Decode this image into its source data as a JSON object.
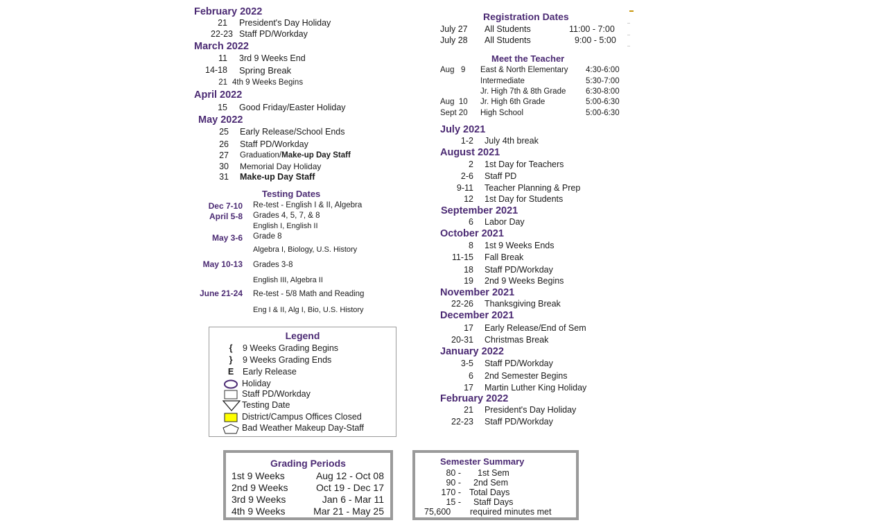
{
  "left_column": {
    "months": [
      {
        "title": "February 2022",
        "events": [
          {
            "date": "21",
            "text": "President's Day Holiday"
          },
          {
            "date": "22-23",
            "text": "Staff PD/Workday"
          }
        ]
      },
      {
        "title": "March 2022",
        "events": [
          {
            "date": "11",
            "text": "3rd 9 Weeks End"
          },
          {
            "date": "14-18",
            "text": "Spring Break"
          },
          {
            "date": "21",
            "text": "4th 9 Weeks Begins"
          }
        ]
      },
      {
        "title": "April 2022",
        "events": [
          {
            "date": "15",
            "text": "Good Friday/Easter Holiday"
          }
        ]
      },
      {
        "title": "May 2022",
        "events": [
          {
            "date": "25",
            "text": "Early Release/School Ends"
          },
          {
            "date": "26",
            "text": "Staff PD/Workday"
          },
          {
            "date": "27",
            "text": "Graduation/",
            "bold_text": "Make-up Day Staff"
          },
          {
            "date": "30",
            "text": "Memorial Day Holiday"
          },
          {
            "date": "31",
            "text": "",
            "bold_text": "Make-up Day Staff"
          }
        ]
      }
    ]
  },
  "testing": {
    "title": "Testing Dates",
    "rows": [
      {
        "date": "Dec 7-10",
        "lines": [
          "Re-test - English I & II, Algebra"
        ]
      },
      {
        "date": "April 5-8",
        "lines": [
          "Grades 4, 5, 7, & 8",
          "English I, English II"
        ]
      },
      {
        "date": "May 3-6",
        "lines": [
          "Grade 8",
          "Algebra I, Biology, U.S. History"
        ]
      },
      {
        "date": "May 10-13",
        "lines": [
          "Grades 3-8",
          "English III, Algebra II"
        ]
      },
      {
        "date": "June 21-24",
        "lines": [
          "Re-test - 5/8 Math and Reading",
          "Eng I & II, Alg I, Bio, U.S. History"
        ]
      }
    ]
  },
  "legend": {
    "title": "Legend",
    "items": [
      {
        "symbol": "{",
        "icon": "open-brace-icon",
        "label": "9 Weeks Grading Begins"
      },
      {
        "symbol": "}",
        "icon": "close-brace-icon",
        "label": "9 Weeks Grading Ends"
      },
      {
        "symbol": "E",
        "icon": "letter-e-icon",
        "label": "Early Release"
      },
      {
        "symbol": "",
        "icon": "oval-icon",
        "label": "Holiday"
      },
      {
        "symbol": "",
        "icon": "square-icon",
        "label": "Staff PD/Workday"
      },
      {
        "symbol": "",
        "icon": "triangle-down-icon",
        "label": "Testing Date"
      },
      {
        "symbol": "",
        "icon": "yellow-square-icon",
        "label": "District/Campus Offices Closed",
        "color": "#ffff00"
      },
      {
        "symbol": "",
        "icon": "pentagon-icon",
        "label": "Bad Weather Makeup Day-Staff"
      }
    ]
  },
  "grading_periods": {
    "title": "Grading Periods",
    "rows": [
      {
        "period": "1st 9 Weeks",
        "dates": "Aug 12 - Oct 08"
      },
      {
        "period": "2nd 9 Weeks",
        "dates": "Oct 19 - Dec 17"
      },
      {
        "period": "3rd 9 Weeks",
        "dates": "Jan 6 - Mar 11"
      },
      {
        "period": "4th 9 Weeks",
        "dates": "Mar 21 - May 25"
      }
    ]
  },
  "semester_summary": {
    "title": "Semester Summary",
    "rows": [
      {
        "value": "80 -",
        "label": "1st Sem"
      },
      {
        "value": "90 -",
        "label": "2nd Sem"
      },
      {
        "value": "170 -",
        "label": "Total Days"
      },
      {
        "value": "15 -",
        "label": "Staff Days"
      },
      {
        "value": "75,600",
        "label": "required minutes met"
      }
    ]
  },
  "registration": {
    "title": "Registration Dates",
    "rows": [
      {
        "date": "July 27",
        "who": "All Students",
        "time": "11:00 - 7:00"
      },
      {
        "date": "July 28",
        "who": "All Students",
        "time": "9:00 - 5:00"
      }
    ]
  },
  "meet_teacher": {
    "title": "Meet the Teacher",
    "rows": [
      {
        "date": "Aug   9",
        "who": "East & North Elementary",
        "time": "4:30-6:00"
      },
      {
        "date": "",
        "who": "Intermediate",
        "time": "5:30-7:00"
      },
      {
        "date": "",
        "who": "Jr. High 7th & 8th Grade",
        "time": "6:30-8:00"
      },
      {
        "date": "Aug  10",
        "who": "Jr. High 6th Grade",
        "time": "5:00-6:30"
      },
      {
        "date": "Sept 20",
        "who": "High School",
        "time": "5:00-6:30"
      }
    ]
  },
  "right_column": {
    "months": [
      {
        "title": "July 2021",
        "events": [
          {
            "date": "1-2",
            "text": "July 4th break"
          }
        ]
      },
      {
        "title": "August 2021",
        "events": [
          {
            "date": "2",
            "text": "1st Day for Teachers"
          },
          {
            "date": "2-6",
            "text": "Staff PD"
          },
          {
            "date": "9-11",
            "text": "Teacher Planning & Prep"
          },
          {
            "date": "12",
            "text": "1st Day for Students"
          }
        ]
      },
      {
        "title": "September 2021",
        "events": [
          {
            "date": "6",
            "text": "Labor Day"
          }
        ]
      },
      {
        "title": "October 2021",
        "events": [
          {
            "date": "8",
            "text": "1st 9 Weeks Ends"
          },
          {
            "date": "11-15",
            "text": "Fall Break"
          },
          {
            "date": "18",
            "text": "Staff PD/Workday"
          },
          {
            "date": "19",
            "text": "2nd 9 Weeks Begins"
          }
        ]
      },
      {
        "title": "November 2021",
        "events": [
          {
            "date": "22-26",
            "text": "Thanksgiving Break"
          }
        ]
      },
      {
        "title": "December 2021",
        "events": [
          {
            "date": "17",
            "text": "Early Release/End of Sem"
          },
          {
            "date": "20-31",
            "text": "Christmas Break"
          }
        ]
      },
      {
        "title": "January 2022",
        "events": [
          {
            "date": "3-5",
            "text": "Staff PD/Workday"
          },
          {
            "date": "6",
            "text": "2nd Semester Begins"
          },
          {
            "date": "17",
            "text": "Martin Luther King Holiday"
          }
        ]
      },
      {
        "title": "February 2022",
        "events": [
          {
            "date": "21",
            "text": "President's Day Holiday"
          },
          {
            "date": "22-23",
            "text": "Staff PD/Workday"
          }
        ]
      }
    ]
  },
  "colors": {
    "heading": "#4b2a73",
    "offices_closed": "#ffff00",
    "box_border": "#9a9a9a"
  }
}
